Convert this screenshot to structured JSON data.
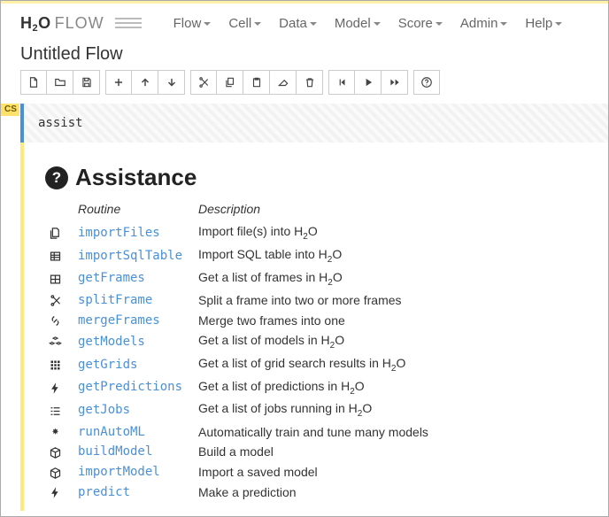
{
  "brand": {
    "h": "H",
    "two": "2",
    "o": "O",
    "flow": "FLOW"
  },
  "menus": [
    "Flow",
    "Cell",
    "Data",
    "Model",
    "Score",
    "Admin",
    "Help"
  ],
  "doc_title": "Untitled Flow",
  "toolbar": {
    "new": "new-file",
    "open": "open-file",
    "save": "save-file",
    "add": "add-cell",
    "up": "move-up",
    "down": "move-down",
    "cut": "cut",
    "copy": "copy",
    "paste": "paste",
    "erase": "erase",
    "trash": "delete",
    "run_back": "run-prev",
    "run": "run",
    "run_all": "run-all",
    "help": "help"
  },
  "cell": {
    "badge": "CS",
    "code": "assist"
  },
  "assist": {
    "heading": "Assistance",
    "cols": {
      "routine": "Routine",
      "desc": "Description"
    },
    "rows": [
      {
        "icon": "files",
        "name": "importFiles",
        "desc": "Import file(s) into H₂O"
      },
      {
        "icon": "db",
        "name": "importSqlTable",
        "desc": "Import SQL table into H₂O"
      },
      {
        "icon": "table",
        "name": "getFrames",
        "desc": "Get a list of frames in H₂O"
      },
      {
        "icon": "scissors",
        "name": "splitFrame",
        "desc": "Split a frame into two or more frames"
      },
      {
        "icon": "link",
        "name": "mergeFrames",
        "desc": "Merge two frames into one"
      },
      {
        "icon": "cubes",
        "name": "getModels",
        "desc": "Get a list of models in H₂O"
      },
      {
        "icon": "grid",
        "name": "getGrids",
        "desc": "Get a list of grid search results in H₂O"
      },
      {
        "icon": "bolt",
        "name": "getPredictions",
        "desc": "Get a list of predictions in H₂O"
      },
      {
        "icon": "tasks",
        "name": "getJobs",
        "desc": "Get a list of jobs running in H₂O"
      },
      {
        "icon": "magic",
        "name": "runAutoML",
        "desc": "Automatically train and tune many models"
      },
      {
        "icon": "cube",
        "name": "buildModel",
        "desc": "Build a model"
      },
      {
        "icon": "cube",
        "name": "importModel",
        "desc": "Import a saved model"
      },
      {
        "icon": "bolt",
        "name": "predict",
        "desc": "Make a prediction"
      }
    ]
  }
}
